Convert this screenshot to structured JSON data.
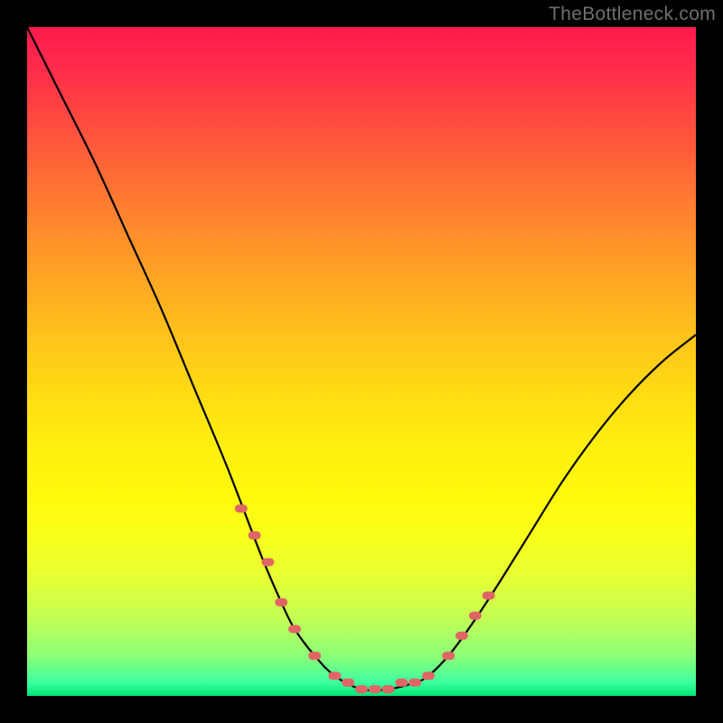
{
  "watermark_text": "TheBottleneck.com",
  "colors": {
    "page_bg": "#000000",
    "gradient_top": "#ff1a4d",
    "gradient_bottom": "#00e676",
    "curve_stroke": "#000000",
    "marker_fill": "#e06666",
    "watermark_text": "#6f6f6f"
  },
  "chart_data": {
    "type": "line",
    "title": "",
    "xlabel": "",
    "ylabel": "",
    "xlim": [
      0,
      100
    ],
    "ylim": [
      0,
      100
    ],
    "note": "Axes are unlabeled; x/y normalized 0–100. y ≈ bottleneck % (0 at bottom).",
    "series": [
      {
        "name": "bottleneck-curve",
        "x": [
          0,
          5,
          10,
          15,
          20,
          25,
          30,
          35,
          38,
          40,
          43,
          46,
          50,
          54,
          58,
          60,
          63,
          66,
          70,
          75,
          80,
          85,
          90,
          95,
          100
        ],
        "y": [
          100,
          90,
          80,
          69,
          58,
          46,
          34,
          21,
          14,
          10,
          6,
          3,
          1,
          1,
          2,
          3,
          6,
          10,
          16,
          24,
          32,
          39,
          45,
          50,
          54
        ]
      }
    ],
    "markers": {
      "name": "highlighted-points",
      "x": [
        32,
        34,
        36,
        38,
        40,
        43,
        46,
        48,
        50,
        52,
        54,
        56,
        58,
        60,
        63,
        65,
        67,
        69
      ],
      "y": [
        28,
        24,
        20,
        14,
        10,
        6,
        3,
        2,
        1,
        1,
        1,
        2,
        2,
        3,
        6,
        9,
        12,
        15
      ]
    }
  }
}
